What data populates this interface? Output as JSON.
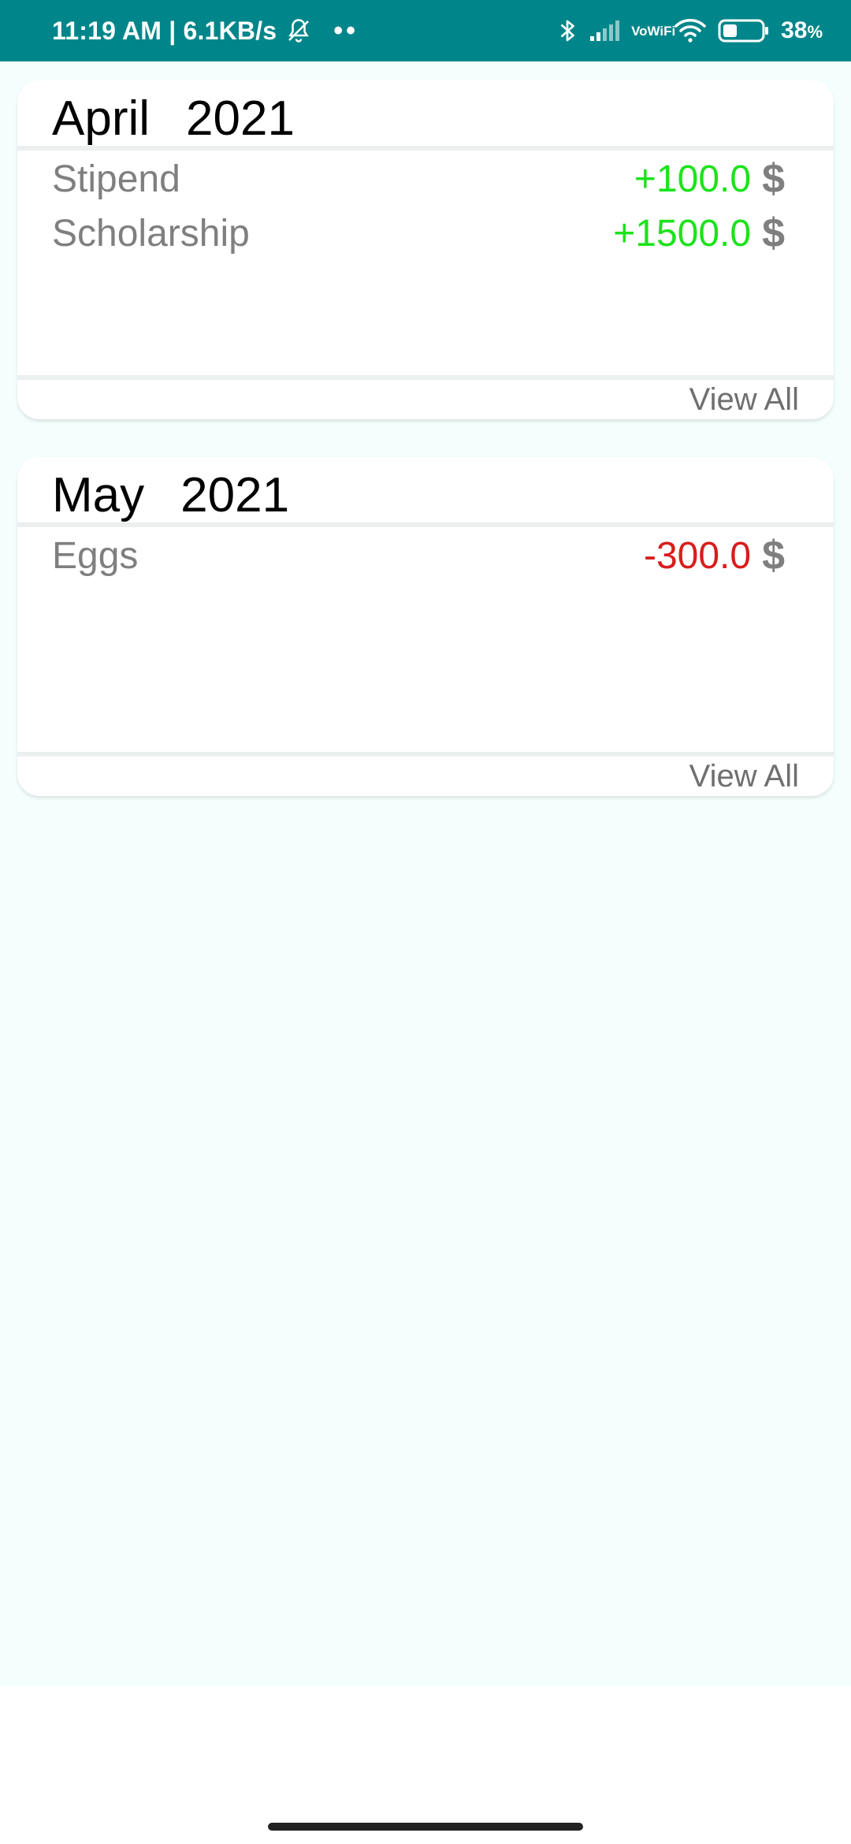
{
  "status_bar": {
    "time_speed": "11:19 AM | 6.1KB/s",
    "dots": "••",
    "vowifi_top": "Vo",
    "vowifi_bottom": "WiFi",
    "battery_percent": "38",
    "battery_unit": "%",
    "battery_level": 0.38,
    "background_color": "#00868a",
    "icons": [
      "bell-off-icon",
      "bluetooth-icon",
      "signal-icon",
      "wifi-icon",
      "battery-icon"
    ]
  },
  "cards": [
    {
      "month": "April",
      "year": "2021",
      "entries": [
        {
          "name": "Stipend",
          "amount": "+100.0",
          "currency": "$",
          "type": "income"
        },
        {
          "name": "Scholarship",
          "amount": "+1500.0",
          "currency": "$",
          "type": "income"
        }
      ],
      "view_all_label": "View All"
    },
    {
      "month": "May",
      "year": "2021",
      "entries": [
        {
          "name": "Eggs",
          "amount": "-300.0",
          "currency": "$",
          "type": "expense"
        }
      ],
      "view_all_label": "View All"
    }
  ],
  "colors": {
    "income": "#1de21d",
    "expense": "#d81d1d",
    "content_background": "#f4fefd"
  }
}
